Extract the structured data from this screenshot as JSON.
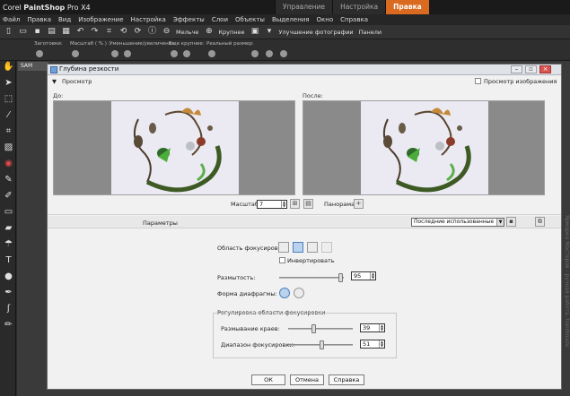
{
  "app": {
    "brand_prefix": "Corel",
    "brand_name": "PaintShop",
    "brand_suffix": "Pro X4",
    "workspace_tabs": [
      {
        "label": "Управление",
        "active": false
      },
      {
        "label": "Настройка",
        "active": false
      },
      {
        "label": "Правка",
        "active": true
      }
    ]
  },
  "menu": [
    "Файл",
    "Правка",
    "Вид",
    "Изображение",
    "Настройка",
    "Эффекты",
    "Слои",
    "Объекты",
    "Выделения",
    "Окно",
    "Справка"
  ],
  "toolbar": {
    "smaller_label": "Мельче",
    "larger_label": "Крупнее",
    "enhance_label": "Улучшение фотографии",
    "panels_label": "Панели"
  },
  "options_bar": {
    "presets_label": "Заготовки:",
    "scale_label": "Масштаб ( % ) :",
    "zoom_label": "Уменьшение/увеличение:",
    "more_label": "Еще крупнее:",
    "actual_label": "Реальный размер:"
  },
  "document_tab": {
    "label": "SAM"
  },
  "dialog": {
    "title": "Глубина резкости",
    "preview_section": "Просмотр",
    "preview_image_label": "Просмотр изображения",
    "before_label": "До:",
    "after_label": "После:",
    "zoom_label": "Масштаб:",
    "zoom_value": "7",
    "pan_label": "Панорама:",
    "params_label": "Параметры",
    "preset_value": "Последние использованные",
    "focus_area_label": "Область фокусировки:",
    "invert_label": "Инвертировать",
    "blur_label": "Размытость:",
    "blur_value": "95",
    "blur_fraction": 0.95,
    "aperture_label": "Форма диафрагмы:",
    "group_label": "Регулировка области фокусировки",
    "edge_blur_label": "Размывание краев:",
    "edge_blur_value": "39",
    "edge_blur_fraction": 0.39,
    "focus_range_label": "Диапазон фокусировки:",
    "focus_range_value": "51",
    "focus_range_fraction": 0.51,
    "ok_label": "ОК",
    "cancel_label": "Отмена",
    "help_label": "Справка"
  },
  "colors": {
    "active_tab": "#d96a1f",
    "dialog_bg": "#f1f1f1",
    "selected_btn": "#b9d3ee"
  },
  "watermark": "Ярмарка Мастеров - ручная работа, handmade"
}
